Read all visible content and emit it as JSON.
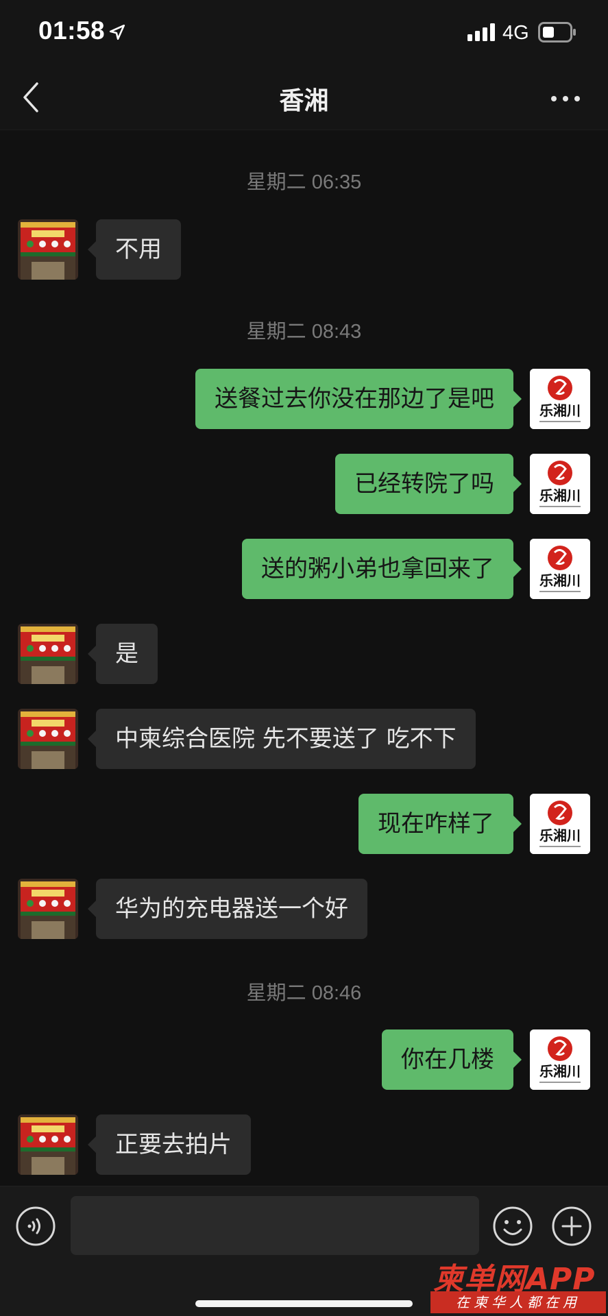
{
  "status_bar": {
    "time": "01:58",
    "network": "4G",
    "icons": [
      "location-arrow-icon",
      "signal-bars-icon",
      "battery-icon"
    ]
  },
  "nav": {
    "title": "香湘",
    "back_icon": "chevron-left-icon",
    "more_icon": "more-dots-icon"
  },
  "timestamps": [
    "星期二 06:35",
    "星期二 08:43",
    "星期二 08:46"
  ],
  "messages": [
    {
      "side": "in",
      "text": "不用"
    },
    {
      "side": "out",
      "text": "送餐过去你没在那边了是吧"
    },
    {
      "side": "out",
      "text": "已经转院了吗"
    },
    {
      "side": "out",
      "text": "送的粥小弟也拿回来了"
    },
    {
      "side": "in",
      "text": "是"
    },
    {
      "side": "in",
      "text": "中柬综合医院 先不要送了 吃不下"
    },
    {
      "side": "out",
      "text": "现在咋样了"
    },
    {
      "side": "in",
      "text": "华为的充电器送一个好"
    },
    {
      "side": "out",
      "text": "你在几楼"
    },
    {
      "side": "in",
      "text": "正要去拍片"
    }
  ],
  "avatars": {
    "self_logo_text": "乐湘川",
    "contact_sign_text": "乐湘川"
  },
  "input_bar": {
    "placeholder": "",
    "icons": [
      "voice-icon",
      "emoji-icon",
      "plus-icon"
    ]
  },
  "watermark": {
    "name": "柬单网APP",
    "tagline": "在柬华人都在用"
  },
  "colors": {
    "background": "#111111",
    "outgoing_bubble": "#5fba6b",
    "incoming_bubble": "#2c2c2c",
    "watermark_red": "#e0392b"
  }
}
